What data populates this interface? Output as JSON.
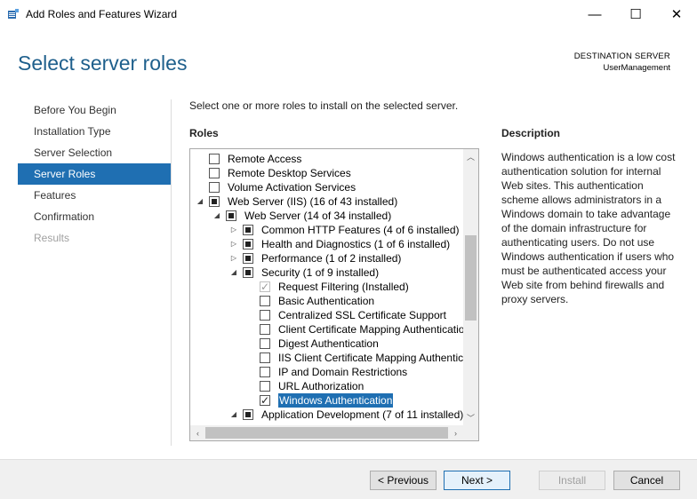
{
  "window": {
    "title": "Add Roles and Features Wizard",
    "minimize": "—",
    "maximize": "☐",
    "close": "✕"
  },
  "header": {
    "page_title": "Select server roles",
    "destination_label": "DESTINATION SERVER",
    "destination_server": "UserManagement"
  },
  "nav": {
    "items": [
      {
        "label": "Before You Begin",
        "state": "normal"
      },
      {
        "label": "Installation Type",
        "state": "normal"
      },
      {
        "label": "Server Selection",
        "state": "normal"
      },
      {
        "label": "Server Roles",
        "state": "active"
      },
      {
        "label": "Features",
        "state": "normal"
      },
      {
        "label": "Confirmation",
        "state": "normal"
      },
      {
        "label": "Results",
        "state": "disabled"
      }
    ]
  },
  "content": {
    "instruction": "Select one or more roles to install on the selected server.",
    "roles_heading": "Roles",
    "description_heading": "Description",
    "description_text": "Windows authentication is a low cost authentication solution for internal Web sites. This authentication scheme allows administrators in a Windows domain to take advantage of the domain infrastructure for authenticating users. Do not use Windows authentication if users who must be authenticated access your Web site from behind firewalls and proxy servers."
  },
  "roles_tree": [
    {
      "label": "Remote Access",
      "level": 0,
      "expander": "",
      "check": "unchecked"
    },
    {
      "label": "Remote Desktop Services",
      "level": 0,
      "expander": "",
      "check": "unchecked"
    },
    {
      "label": "Volume Activation Services",
      "level": 0,
      "expander": "",
      "check": "unchecked"
    },
    {
      "label": "Web Server (IIS) (16 of 43 installed)",
      "level": 0,
      "expander": "expanded",
      "check": "partial"
    },
    {
      "label": "Web Server (14 of 34 installed)",
      "level": 1,
      "expander": "expanded",
      "check": "partial"
    },
    {
      "label": "Common HTTP Features (4 of 6 installed)",
      "level": 2,
      "expander": "collapsed",
      "check": "partial"
    },
    {
      "label": "Health and Diagnostics (1 of 6 installed)",
      "level": 2,
      "expander": "collapsed",
      "check": "partial"
    },
    {
      "label": "Performance (1 of 2 installed)",
      "level": 2,
      "expander": "collapsed",
      "check": "partial"
    },
    {
      "label": "Security (1 of 9 installed)",
      "level": 2,
      "expander": "expanded",
      "check": "partial"
    },
    {
      "label": "Request Filtering (Installed)",
      "level": 3,
      "expander": "",
      "check": "disabled-checked"
    },
    {
      "label": "Basic Authentication",
      "level": 3,
      "expander": "",
      "check": "unchecked"
    },
    {
      "label": "Centralized SSL Certificate Support",
      "level": 3,
      "expander": "",
      "check": "unchecked"
    },
    {
      "label": "Client Certificate Mapping Authenticatio",
      "level": 3,
      "expander": "",
      "check": "unchecked"
    },
    {
      "label": "Digest Authentication",
      "level": 3,
      "expander": "",
      "check": "unchecked"
    },
    {
      "label": "IIS Client Certificate Mapping Authentic",
      "level": 3,
      "expander": "",
      "check": "unchecked"
    },
    {
      "label": "IP and Domain Restrictions",
      "level": 3,
      "expander": "",
      "check": "unchecked"
    },
    {
      "label": "URL Authorization",
      "level": 3,
      "expander": "",
      "check": "unchecked"
    },
    {
      "label": "Windows Authentication",
      "level": 3,
      "expander": "",
      "check": "checked",
      "selected": true
    },
    {
      "label": "Application Development (7 of 11 installed)",
      "level": 2,
      "expander": "expanded",
      "check": "partial"
    }
  ],
  "scrollbar": {
    "up": "︿",
    "down": "﹀",
    "left": "‹",
    "right": "›"
  },
  "footer": {
    "previous_label": "< Previous",
    "next_label": "Next >",
    "install_label": "Install",
    "cancel_label": "Cancel"
  },
  "colors": {
    "accent": "#1f6fb2",
    "title_blue": "#1e5f8c"
  }
}
